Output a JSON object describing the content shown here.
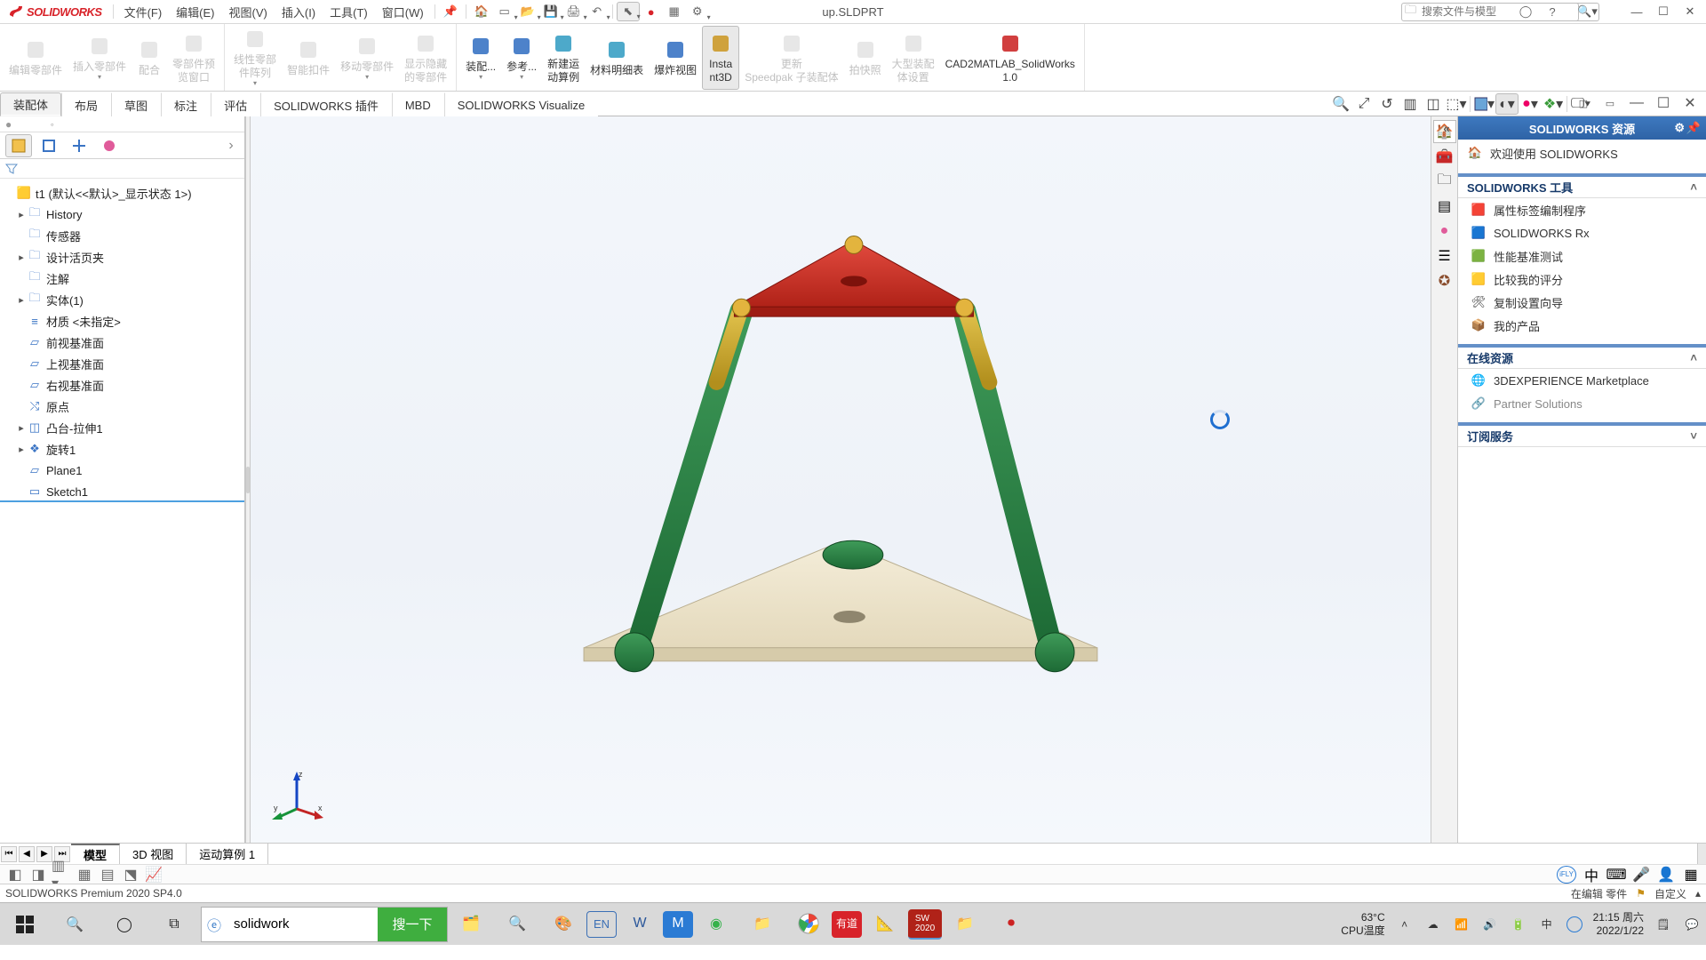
{
  "app": {
    "brand": "SOLIDWORKS",
    "doc_title": "up.SLDPRT"
  },
  "menu": [
    "文件(F)",
    "编辑(E)",
    "视图(V)",
    "插入(I)",
    "工具(T)",
    "窗口(W)"
  ],
  "search": {
    "placeholder": "搜索文件与模型"
  },
  "ribbon_groups": [
    {
      "buttons": [
        {
          "label": "编辑零部件",
          "enabled": false
        },
        {
          "label": "插入零部件",
          "enabled": false,
          "dd": true
        },
        {
          "label": "配合",
          "enabled": false
        },
        {
          "label": "零部件预览窗口",
          "enabled": false
        }
      ]
    },
    {
      "buttons": [
        {
          "label": "线性零部件阵列",
          "enabled": false,
          "dd": true
        },
        {
          "label": "智能扣件",
          "enabled": false
        },
        {
          "label": "移动零部件",
          "enabled": false,
          "dd": true
        },
        {
          "label": "显示隐藏的零部件",
          "enabled": false
        }
      ]
    },
    {
      "buttons": [
        {
          "label": "装配...",
          "enabled": true,
          "dd": true,
          "hue": "#3a74c4"
        },
        {
          "label": "参考...",
          "enabled": true,
          "dd": true,
          "hue": "#3a74c4"
        },
        {
          "label": "新建运动算例",
          "enabled": true,
          "hue": "#3aa0c4"
        },
        {
          "label": "材料明细表",
          "enabled": true,
          "hue": "#3aa0c4"
        },
        {
          "label": "爆炸视图",
          "enabled": true,
          "hue": "#3a74c4"
        },
        {
          "label": "Instant3D",
          "enabled": true,
          "active": true,
          "hue": "#cc9a2a"
        },
        {
          "label": "更新 Speedpak 子装配体",
          "enabled": false
        },
        {
          "label": "拍快照",
          "enabled": false
        },
        {
          "label": "大型装配体设置",
          "enabled": false
        },
        {
          "label": "CAD2MATLAB_SolidWorks 1.0",
          "enabled": true,
          "hue": "#cc2a2a"
        }
      ]
    }
  ],
  "tabs": [
    "装配体",
    "布局",
    "草图",
    "标注",
    "评估",
    "SOLIDWORKS 插件",
    "MBD",
    "SOLIDWORKS Visualize"
  ],
  "tabs_active_index": 0,
  "fm_tree": [
    {
      "exp": "",
      "icon": "part",
      "label": "t1 (默认<<默认>_显示状态 1>)",
      "depth": 0,
      "selected": false,
      "gold": true
    },
    {
      "exp": "▸",
      "icon": "folder",
      "label": "History",
      "depth": 1
    },
    {
      "exp": "",
      "icon": "sensor",
      "label": "传感器",
      "depth": 1
    },
    {
      "exp": "▸",
      "icon": "folder",
      "label": "设计活页夹",
      "depth": 1
    },
    {
      "exp": "",
      "icon": "note",
      "label": "注解",
      "depth": 1
    },
    {
      "exp": "▸",
      "icon": "solid",
      "label": "实体(1)",
      "depth": 1
    },
    {
      "exp": "",
      "icon": "material",
      "label": "材质 <未指定>",
      "depth": 1
    },
    {
      "exp": "",
      "icon": "plane",
      "label": "前视基准面",
      "depth": 1
    },
    {
      "exp": "",
      "icon": "plane",
      "label": "上视基准面",
      "depth": 1
    },
    {
      "exp": "",
      "icon": "plane",
      "label": "右视基准面",
      "depth": 1
    },
    {
      "exp": "",
      "icon": "origin",
      "label": "原点",
      "depth": 1
    },
    {
      "exp": "▸",
      "icon": "extrude",
      "label": "凸台-拉伸1",
      "depth": 1
    },
    {
      "exp": "▸",
      "icon": "revolve",
      "label": "旋转1",
      "depth": 1
    },
    {
      "exp": "",
      "icon": "plane",
      "label": "Plane1",
      "depth": 1
    },
    {
      "exp": "",
      "icon": "sketch",
      "label": "Sketch1",
      "depth": 1,
      "selected": true
    }
  ],
  "sidepane": {
    "title": "SOLIDWORKS 资源",
    "welcome": "欢迎使用  SOLIDWORKS",
    "sec_tools": "SOLIDWORKS 工具",
    "tools": [
      "属性标签编制程序",
      "SOLIDWORKS Rx",
      "性能基准测试",
      "比较我的评分",
      "复制设置向导",
      "我的产品"
    ],
    "sec_online": "在线资源",
    "online": [
      "3DEXPERIENCE Marketplace",
      "Partner Solutions"
    ],
    "sec_subs": "订阅服务"
  },
  "bottom_tabs": [
    "模型",
    "3D 视图",
    "运动算例 1"
  ],
  "bottom_active": 0,
  "status": {
    "left": "SOLIDWORKS Premium 2020 SP4.0",
    "right1": "在编辑 零件",
    "right2": "自定义"
  },
  "taskbar": {
    "search_value": "solidwork",
    "search_button": "搜一下",
    "temp_line1": "63°C",
    "temp_line2": "CPU温度",
    "ime": "中",
    "clock_line1": "21:15 周六",
    "clock_line2": "2022/1/22"
  }
}
